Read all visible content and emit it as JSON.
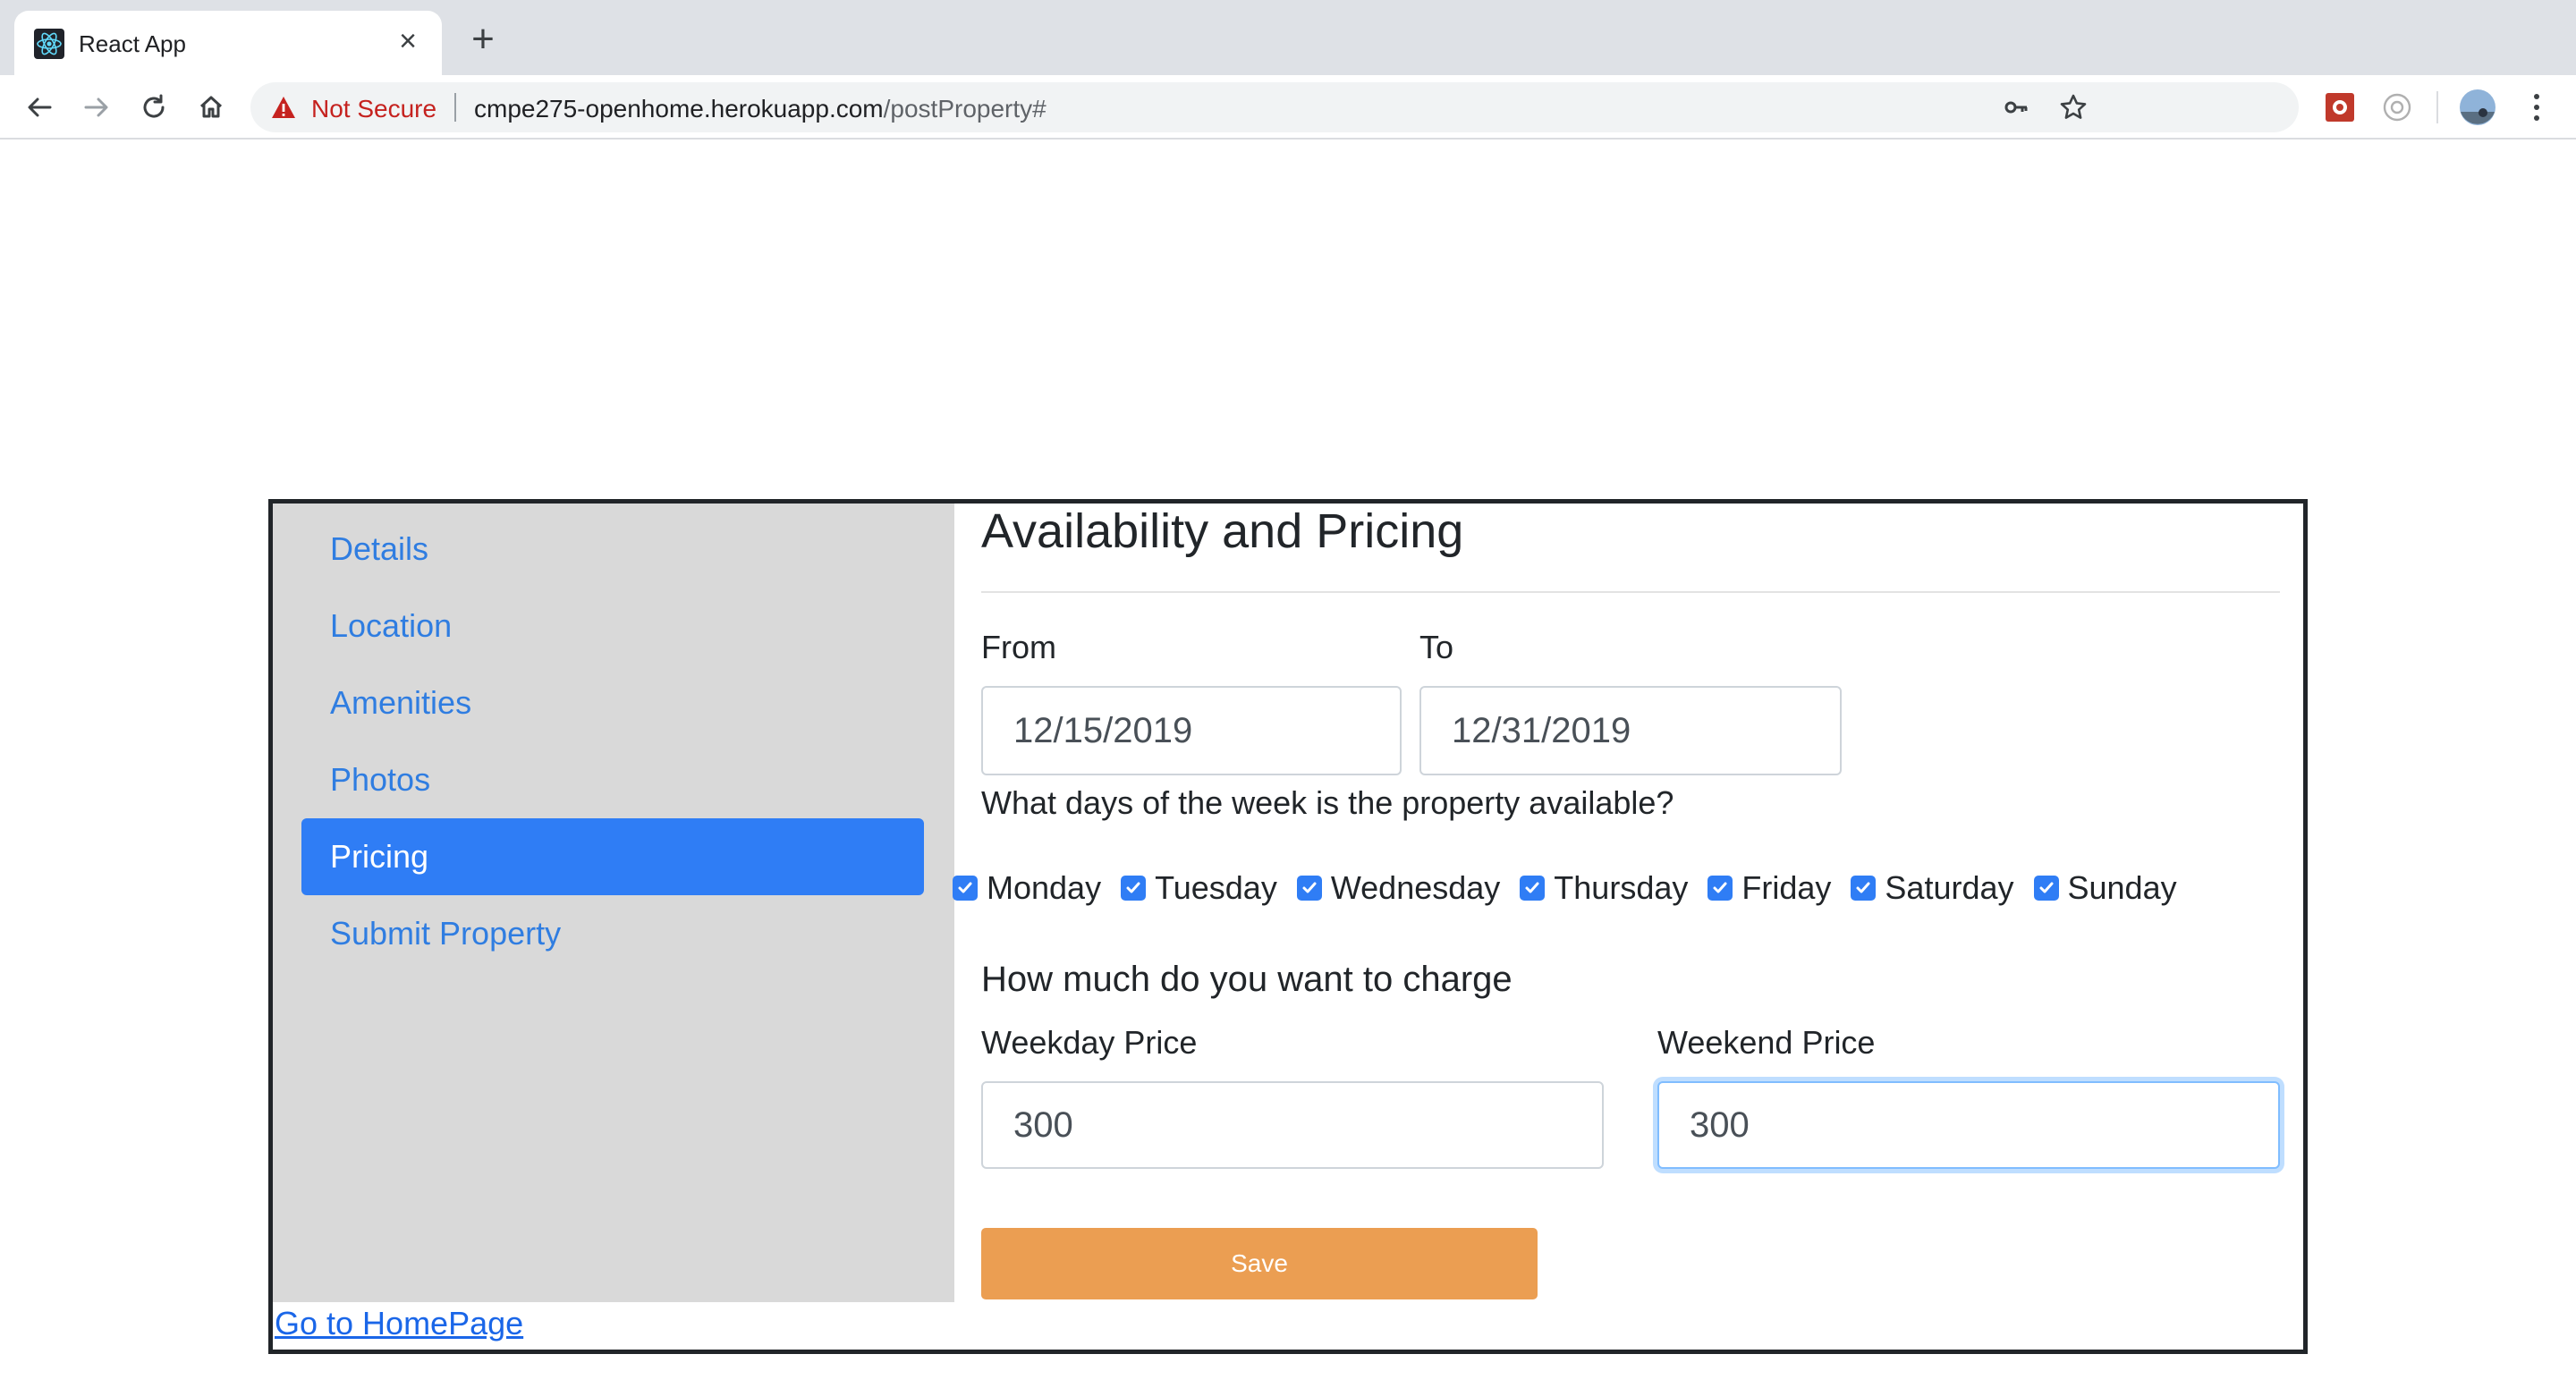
{
  "browser": {
    "tab_title": "React App",
    "url_security": "Not Secure",
    "url_host": "cmpe275-openhome.herokuapp.com",
    "url_path": "/postProperty#",
    "icons": [
      "react-favicon",
      "close-icon",
      "plus-icon",
      "back-arrow-icon",
      "forward-arrow-icon",
      "reload-icon",
      "home-icon",
      "warning-icon",
      "key-icon",
      "star-icon",
      "extension-icon",
      "extension-icon-2",
      "profile-avatar",
      "kebab-menu-icon"
    ]
  },
  "sidebar": {
    "items": [
      {
        "label": "Details"
      },
      {
        "label": "Location"
      },
      {
        "label": "Amenities"
      },
      {
        "label": "Photos"
      },
      {
        "label": "Pricing",
        "active": true
      },
      {
        "label": "Submit Property"
      }
    ],
    "home_link": "Go to HomePage"
  },
  "main": {
    "title": "Availability and Pricing",
    "from_label": "From",
    "from_value": "12/15/2019",
    "to_label": "To",
    "to_value": "12/31/2019",
    "days_question": "What days of the week is the property available?",
    "days": [
      {
        "label": "Monday",
        "checked": true
      },
      {
        "label": "Tuesday",
        "checked": true
      },
      {
        "label": "Wednesday",
        "checked": true
      },
      {
        "label": "Thursday",
        "checked": true
      },
      {
        "label": "Friday",
        "checked": true
      },
      {
        "label": "Saturday",
        "checked": true
      },
      {
        "label": "Sunday",
        "checked": true
      }
    ],
    "charge_heading": "How much do you want to charge",
    "weekday_label": "Weekday Price",
    "weekday_value": "300",
    "weekend_label": "Weekend Price",
    "weekend_value": "300",
    "save_label": "Save"
  },
  "colors": {
    "accent_blue": "#2f7df5",
    "link_blue": "#2f7de1",
    "save_orange": "#eb9e52",
    "sidebar_bg": "#d9d9d9",
    "warning_red": "#c5221f"
  }
}
